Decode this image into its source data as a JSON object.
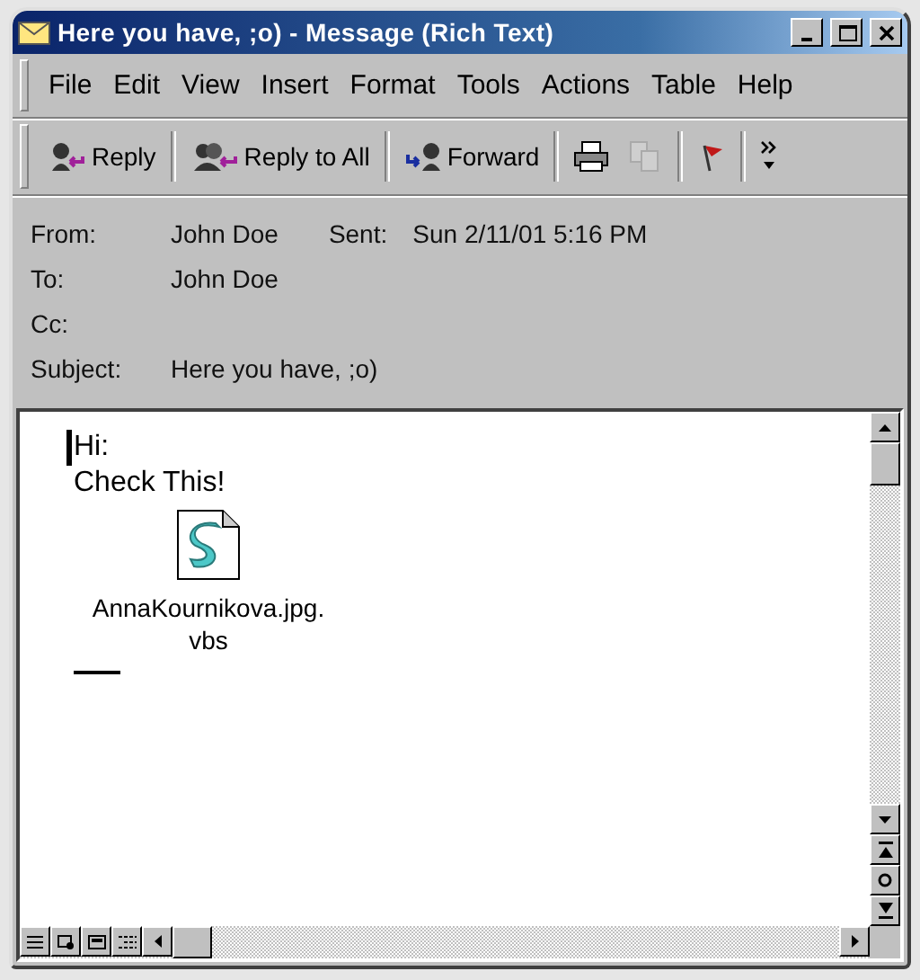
{
  "window": {
    "title": "Here you have, ;o) - Message (Rich Text)"
  },
  "menu": [
    {
      "label": "File"
    },
    {
      "label": "Edit"
    },
    {
      "label": "View"
    },
    {
      "label": "Insert"
    },
    {
      "label": "Format"
    },
    {
      "label": "Tools"
    },
    {
      "label": "Actions"
    },
    {
      "label": "Table"
    },
    {
      "label": "Help"
    }
  ],
  "toolbar": [
    {
      "kind": "reply",
      "label": "Reply"
    },
    {
      "kind": "replyall",
      "label": "Reply to All"
    },
    {
      "kind": "forward",
      "label": "Forward"
    },
    {
      "kind": "print"
    },
    {
      "kind": "copy",
      "disabled": true
    },
    {
      "kind": "flag"
    },
    {
      "kind": "more"
    }
  ],
  "header": {
    "from_label": "From:",
    "from": "John Doe",
    "sent_label": "Sent:",
    "sent": "Sun 2/11/01 5:16 PM",
    "to_label": "To:",
    "to": "John Doe",
    "cc_label": "Cc:",
    "subject_label": "Subject:",
    "subject": "Here you have, ;o)"
  },
  "body": {
    "lines": [
      "Hi:",
      "Check This!"
    ],
    "attachment": "AnnaKournikova.jpg.vbs"
  }
}
